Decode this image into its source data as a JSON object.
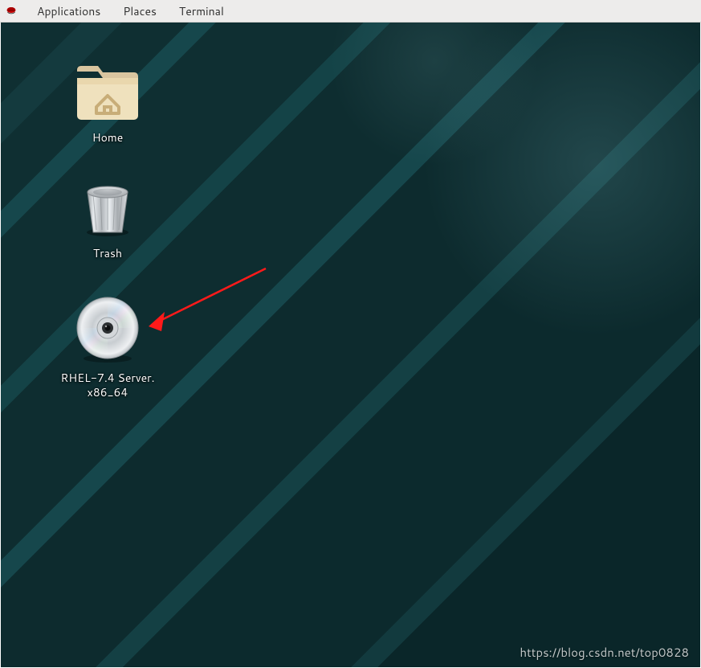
{
  "menubar": {
    "items": [
      {
        "label": "Applications"
      },
      {
        "label": "Places"
      },
      {
        "label": "Terminal"
      }
    ]
  },
  "desktop": {
    "icons": {
      "home": {
        "label": "Home"
      },
      "trash": {
        "label": "Trash"
      },
      "disc": {
        "label": "RHEL-7.4 Server.\nx86_64"
      }
    }
  },
  "watermark": "https://blog.csdn.net/top0828"
}
